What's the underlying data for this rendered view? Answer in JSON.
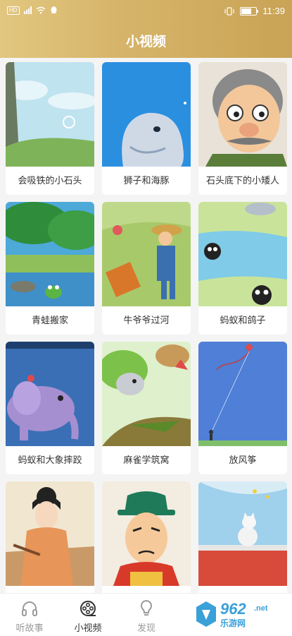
{
  "status": {
    "time": "11:39",
    "hd": "HD"
  },
  "header": {
    "title": "小视频"
  },
  "videos": [
    {
      "title": "会吸铁的小石头",
      "icon": "cartoon-rock-thumbnail"
    },
    {
      "title": "狮子和海豚",
      "icon": "cartoon-dolphin-thumbnail"
    },
    {
      "title": "石头底下的小矮人",
      "icon": "cartoon-old-man-thumbnail"
    },
    {
      "title": "青蛙搬家",
      "icon": "cartoon-frog-thumbnail"
    },
    {
      "title": "牛爷爷过河",
      "icon": "cartoon-farmer-thumbnail"
    },
    {
      "title": "蚂蚁和鸽子",
      "icon": "cartoon-ants-thumbnail"
    },
    {
      "title": "蚂蚁和大象摔跤",
      "icon": "cartoon-elephant-thumbnail"
    },
    {
      "title": "麻雀学筑窝",
      "icon": "cartoon-sparrow-thumbnail"
    },
    {
      "title": "放风筝",
      "icon": "cartoon-kite-thumbnail"
    },
    {
      "title": "",
      "icon": "cartoon-girl-thumbnail"
    },
    {
      "title": "",
      "icon": "cartoon-official-thumbnail"
    },
    {
      "title": "",
      "icon": "cartoon-cat-thumbnail"
    }
  ],
  "tabs": [
    {
      "label": "听故事",
      "icon": "headphones-icon"
    },
    {
      "label": "小视频",
      "icon": "film-reel-icon",
      "active": true
    },
    {
      "label": "发现",
      "icon": "lightbulb-icon"
    }
  ],
  "watermark": {
    "num": "962",
    "suffix": ".net",
    "text": "乐游网"
  },
  "colors": {
    "header_start": "#e2c780",
    "header_end": "#c9a356",
    "active_tab": "#333333",
    "inactive_tab": "#9a9a9a"
  }
}
